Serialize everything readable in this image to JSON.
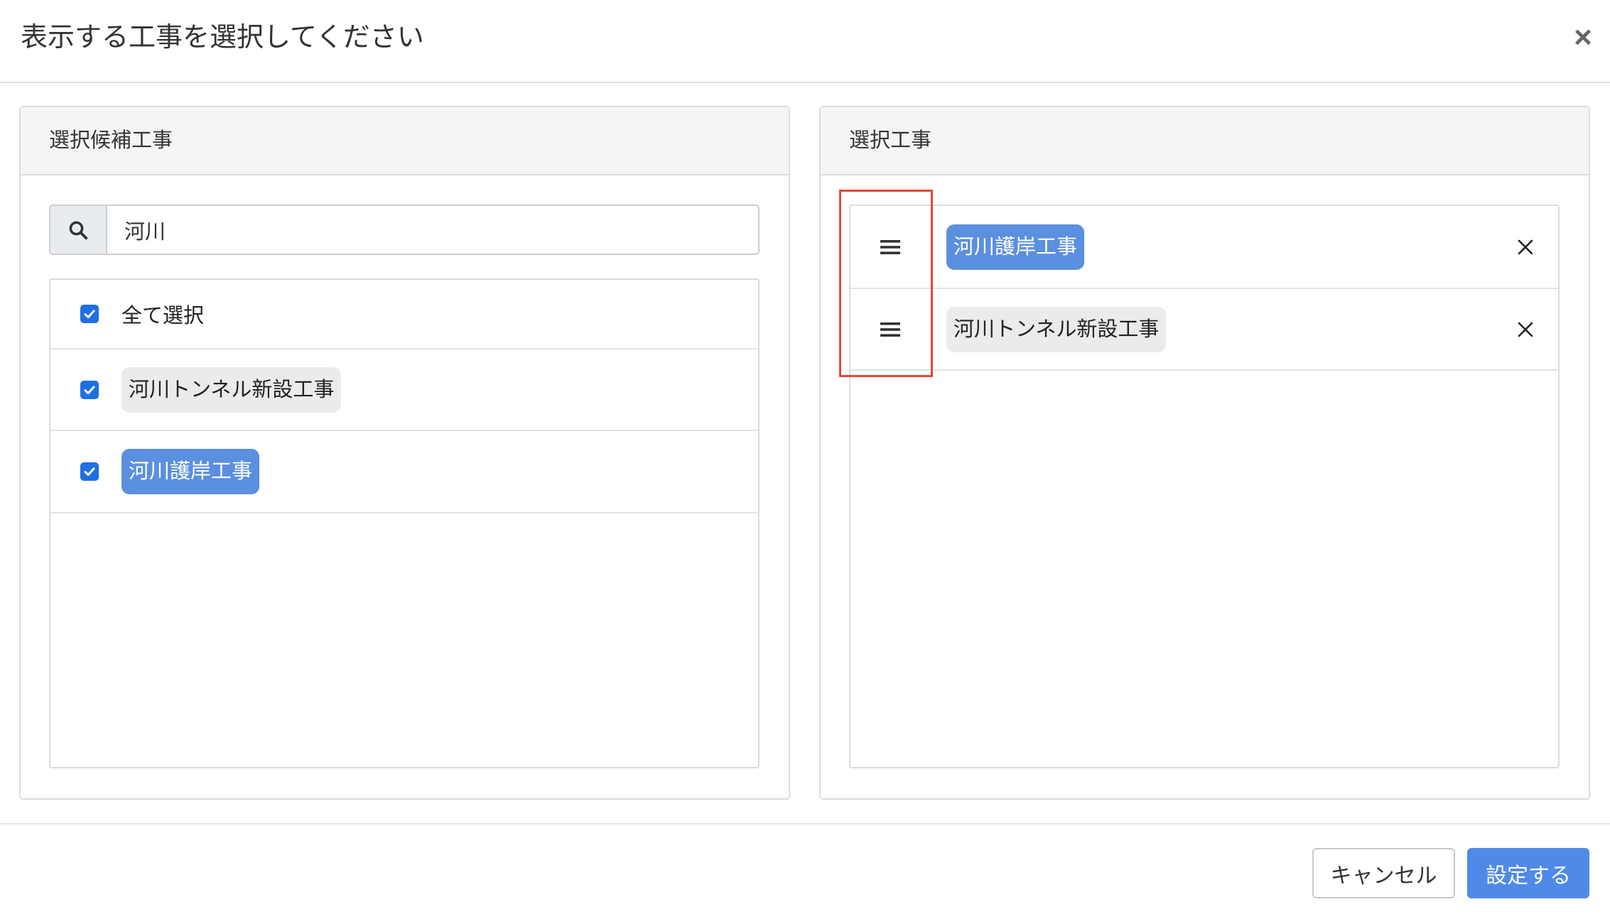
{
  "modal": {
    "title": "表示する工事を選択してください",
    "close_icon": "close-icon"
  },
  "candidates": {
    "title": "選択候補工事",
    "search": {
      "icon": "search-icon",
      "value": "河川"
    },
    "select_all": {
      "label": "全て選択",
      "checked": true
    },
    "items": [
      {
        "label": "河川トンネル新設工事",
        "checked": true,
        "chip_bg": "#ebebeb",
        "chip_fg": "#222222"
      },
      {
        "label": "河川護岸工事",
        "checked": true,
        "chip_bg": "#5b8fdf",
        "chip_fg": "#ffffff"
      }
    ]
  },
  "selected": {
    "title": "選択工事",
    "handle_icon": "drag-handle-icon",
    "remove_icon": "close-icon",
    "items": [
      {
        "label": "河川護岸工事",
        "chip_bg": "#5b8fdf",
        "chip_fg": "#ffffff"
      },
      {
        "label": "河川トンネル新設工事",
        "chip_bg": "#ebebeb",
        "chip_fg": "#222222"
      }
    ]
  },
  "footer": {
    "cancel_label": "キャンセル",
    "submit_label": "設定する"
  },
  "colors": {
    "checkbox": "#1f6fe3",
    "primary_button": "#4f8ae8",
    "annotation_box": "#e24a33"
  }
}
